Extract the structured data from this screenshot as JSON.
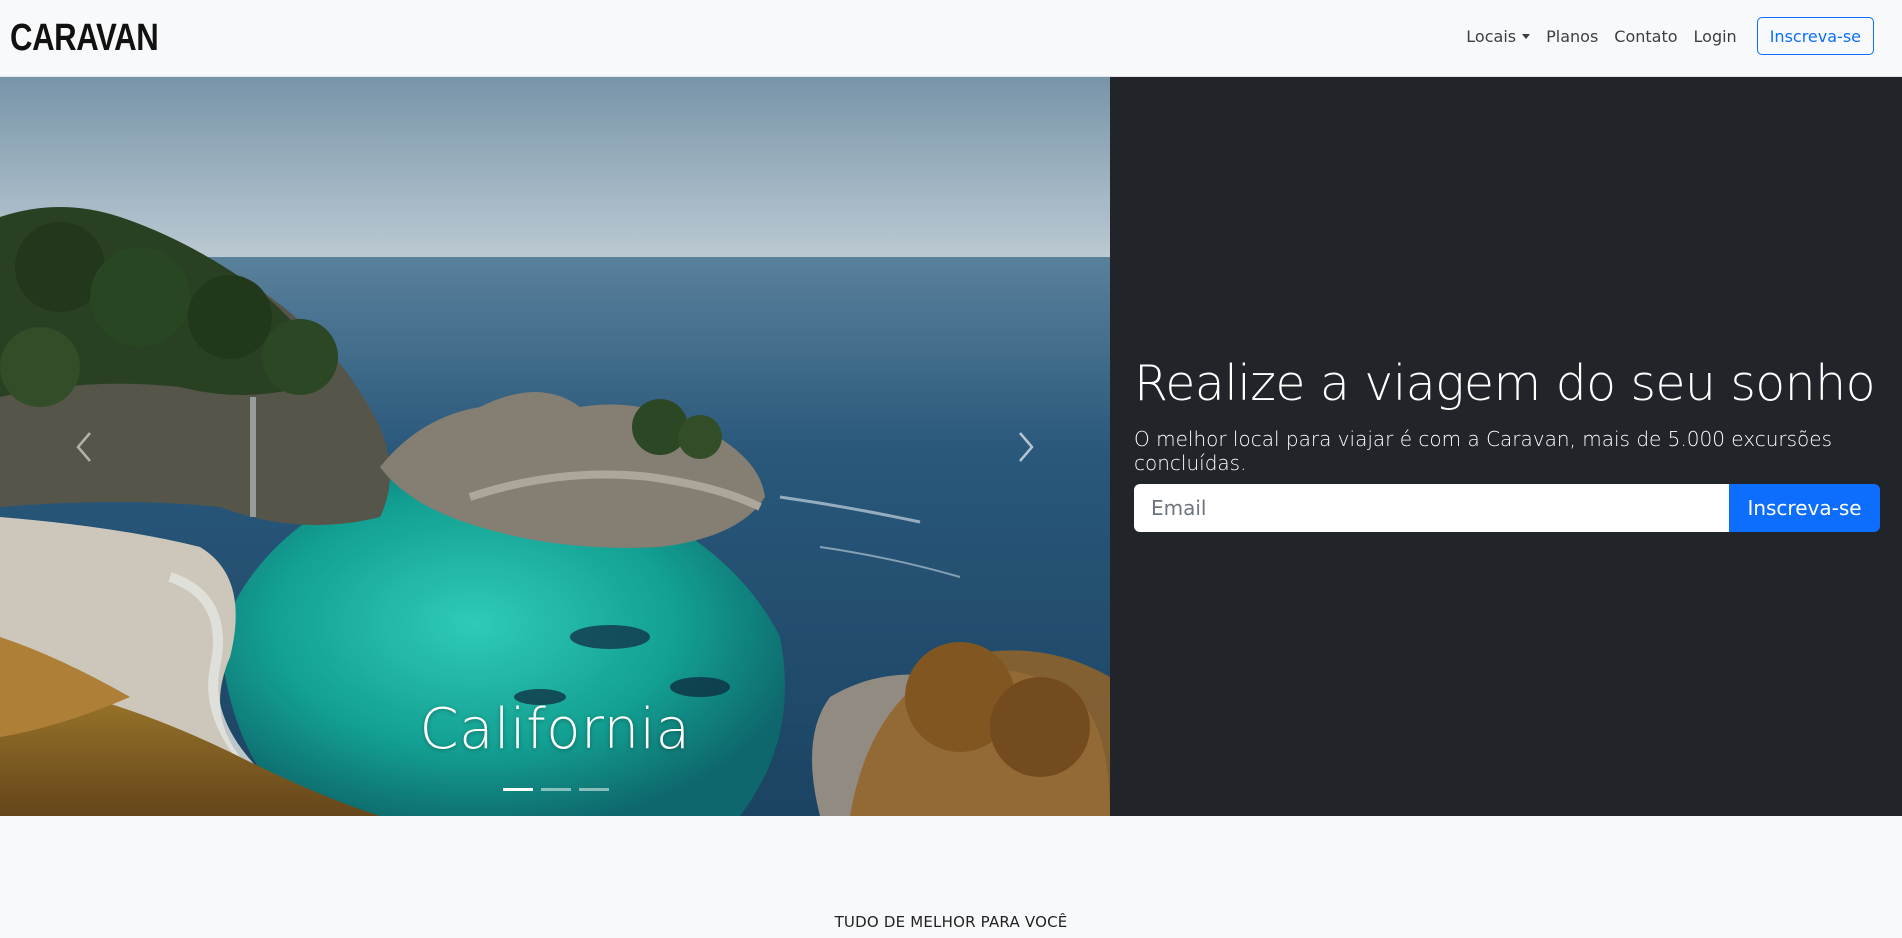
{
  "navbar": {
    "brand": "CARAVAN",
    "links": [
      {
        "label": "Locais",
        "has_dropdown": true
      },
      {
        "label": "Planos"
      },
      {
        "label": "Contato"
      },
      {
        "label": "Login"
      }
    ],
    "signup_label": "Inscreva-se"
  },
  "carousel": {
    "caption": "California",
    "slide_count": 3,
    "active_slide": 1,
    "prev_icon": "chevron-left-icon",
    "next_icon": "chevron-right-icon"
  },
  "hero": {
    "title": "Realize a viagem do seu sonho",
    "subtitle": "O melhor local para viajar é com a Caravan, mais de 5.000 excursões concluídas.",
    "email_placeholder": "Email",
    "submit_label": "Inscreva-se"
  },
  "section": {
    "label": "TUDO DE MELHOR PARA VOCÊ"
  },
  "colors": {
    "accent": "#0d6efd",
    "panel_bg": "#212529",
    "page_bg": "#f8f9fa"
  }
}
